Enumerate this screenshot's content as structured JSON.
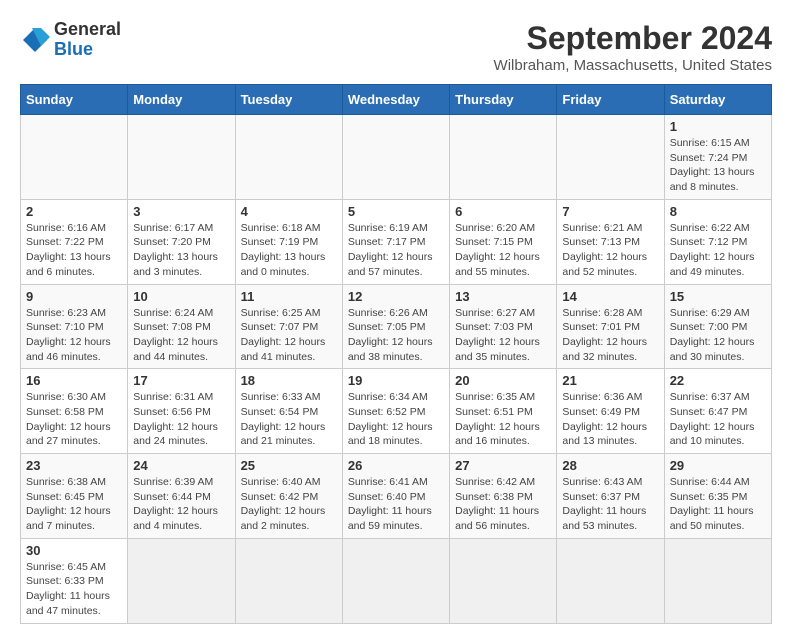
{
  "logo": {
    "line1": "General",
    "line2": "Blue"
  },
  "title": "September 2024",
  "location": "Wilbraham, Massachusetts, United States",
  "weekdays": [
    "Sunday",
    "Monday",
    "Tuesday",
    "Wednesday",
    "Thursday",
    "Friday",
    "Saturday"
  ],
  "days": [
    {
      "num": "",
      "detail": ""
    },
    {
      "num": "",
      "detail": ""
    },
    {
      "num": "",
      "detail": ""
    },
    {
      "num": "",
      "detail": ""
    },
    {
      "num": "",
      "detail": ""
    },
    {
      "num": "",
      "detail": ""
    },
    {
      "num": "1",
      "detail": "Sunrise: 6:15 AM\nSunset: 7:24 PM\nDaylight: 13 hours\nand 8 minutes."
    },
    {
      "num": "2",
      "detail": "Sunrise: 6:16 AM\nSunset: 7:22 PM\nDaylight: 13 hours\nand 6 minutes."
    },
    {
      "num": "3",
      "detail": "Sunrise: 6:17 AM\nSunset: 7:20 PM\nDaylight: 13 hours\nand 3 minutes."
    },
    {
      "num": "4",
      "detail": "Sunrise: 6:18 AM\nSunset: 7:19 PM\nDaylight: 13 hours\nand 0 minutes."
    },
    {
      "num": "5",
      "detail": "Sunrise: 6:19 AM\nSunset: 7:17 PM\nDaylight: 12 hours\nand 57 minutes."
    },
    {
      "num": "6",
      "detail": "Sunrise: 6:20 AM\nSunset: 7:15 PM\nDaylight: 12 hours\nand 55 minutes."
    },
    {
      "num": "7",
      "detail": "Sunrise: 6:21 AM\nSunset: 7:13 PM\nDaylight: 12 hours\nand 52 minutes."
    },
    {
      "num": "8",
      "detail": "Sunrise: 6:22 AM\nSunset: 7:12 PM\nDaylight: 12 hours\nand 49 minutes."
    },
    {
      "num": "9",
      "detail": "Sunrise: 6:23 AM\nSunset: 7:10 PM\nDaylight: 12 hours\nand 46 minutes."
    },
    {
      "num": "10",
      "detail": "Sunrise: 6:24 AM\nSunset: 7:08 PM\nDaylight: 12 hours\nand 44 minutes."
    },
    {
      "num": "11",
      "detail": "Sunrise: 6:25 AM\nSunset: 7:07 PM\nDaylight: 12 hours\nand 41 minutes."
    },
    {
      "num": "12",
      "detail": "Sunrise: 6:26 AM\nSunset: 7:05 PM\nDaylight: 12 hours\nand 38 minutes."
    },
    {
      "num": "13",
      "detail": "Sunrise: 6:27 AM\nSunset: 7:03 PM\nDaylight: 12 hours\nand 35 minutes."
    },
    {
      "num": "14",
      "detail": "Sunrise: 6:28 AM\nSunset: 7:01 PM\nDaylight: 12 hours\nand 32 minutes."
    },
    {
      "num": "15",
      "detail": "Sunrise: 6:29 AM\nSunset: 7:00 PM\nDaylight: 12 hours\nand 30 minutes."
    },
    {
      "num": "16",
      "detail": "Sunrise: 6:30 AM\nSunset: 6:58 PM\nDaylight: 12 hours\nand 27 minutes."
    },
    {
      "num": "17",
      "detail": "Sunrise: 6:31 AM\nSunset: 6:56 PM\nDaylight: 12 hours\nand 24 minutes."
    },
    {
      "num": "18",
      "detail": "Sunrise: 6:33 AM\nSunset: 6:54 PM\nDaylight: 12 hours\nand 21 minutes."
    },
    {
      "num": "19",
      "detail": "Sunrise: 6:34 AM\nSunset: 6:52 PM\nDaylight: 12 hours\nand 18 minutes."
    },
    {
      "num": "20",
      "detail": "Sunrise: 6:35 AM\nSunset: 6:51 PM\nDaylight: 12 hours\nand 16 minutes."
    },
    {
      "num": "21",
      "detail": "Sunrise: 6:36 AM\nSunset: 6:49 PM\nDaylight: 12 hours\nand 13 minutes."
    },
    {
      "num": "22",
      "detail": "Sunrise: 6:37 AM\nSunset: 6:47 PM\nDaylight: 12 hours\nand 10 minutes."
    },
    {
      "num": "23",
      "detail": "Sunrise: 6:38 AM\nSunset: 6:45 PM\nDaylight: 12 hours\nand 7 minutes."
    },
    {
      "num": "24",
      "detail": "Sunrise: 6:39 AM\nSunset: 6:44 PM\nDaylight: 12 hours\nand 4 minutes."
    },
    {
      "num": "25",
      "detail": "Sunrise: 6:40 AM\nSunset: 6:42 PM\nDaylight: 12 hours\nand 2 minutes."
    },
    {
      "num": "26",
      "detail": "Sunrise: 6:41 AM\nSunset: 6:40 PM\nDaylight: 11 hours\nand 59 minutes."
    },
    {
      "num": "27",
      "detail": "Sunrise: 6:42 AM\nSunset: 6:38 PM\nDaylight: 11 hours\nand 56 minutes."
    },
    {
      "num": "28",
      "detail": "Sunrise: 6:43 AM\nSunset: 6:37 PM\nDaylight: 11 hours\nand 53 minutes."
    },
    {
      "num": "29",
      "detail": "Sunrise: 6:44 AM\nSunset: 6:35 PM\nDaylight: 11 hours\nand 50 minutes."
    },
    {
      "num": "30",
      "detail": "Sunrise: 6:45 AM\nSunset: 6:33 PM\nDaylight: 11 hours\nand 47 minutes."
    },
    {
      "num": "",
      "detail": ""
    },
    {
      "num": "",
      "detail": ""
    },
    {
      "num": "",
      "detail": ""
    },
    {
      "num": "",
      "detail": ""
    },
    {
      "num": "",
      "detail": ""
    }
  ]
}
